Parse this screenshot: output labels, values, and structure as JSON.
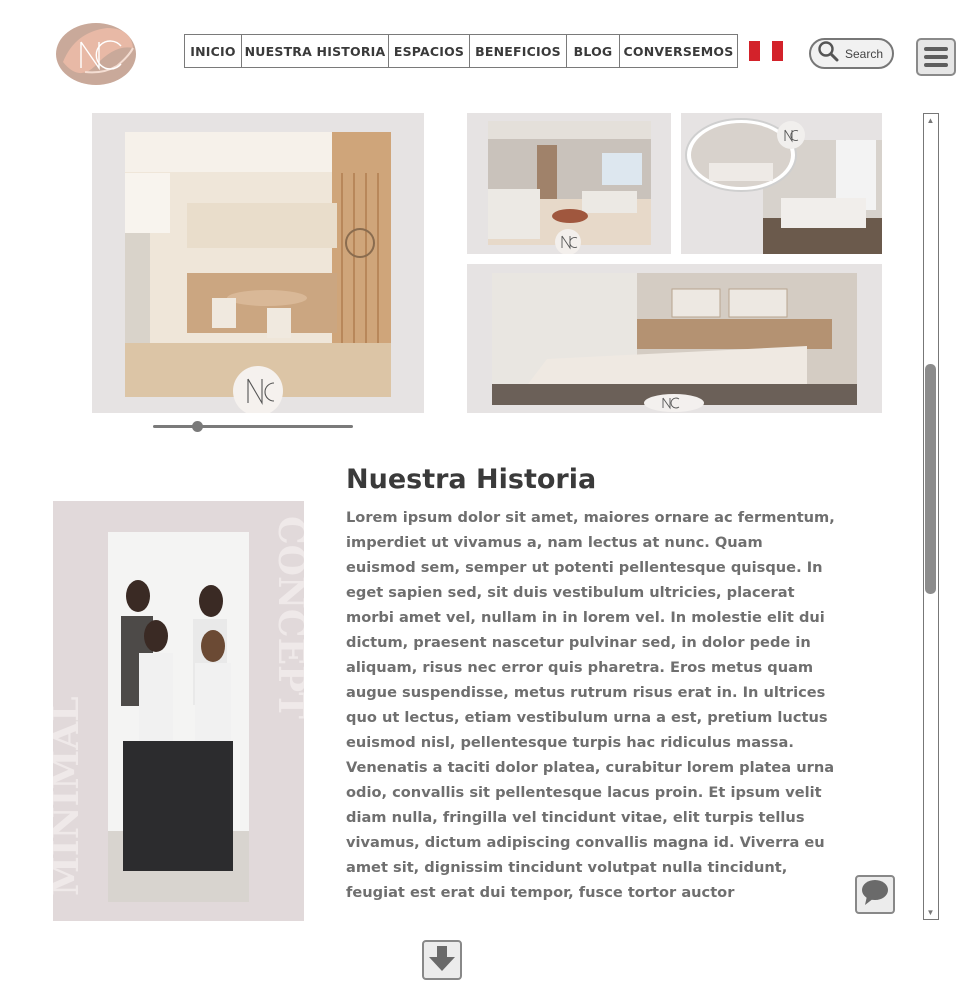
{
  "header": {
    "nav": [
      "INICIO",
      "NUESTRA HISTORIA",
      "ESPACIOS",
      "BENEFICIOS",
      "BLOG",
      "CONVERSEMOS"
    ],
    "search_label": "Search",
    "flag_colors": [
      "#d3222a",
      "#ffffff",
      "#d3222a"
    ],
    "logo_initials": "NC"
  },
  "gallery": {
    "carousel_position": 0.22
  },
  "story": {
    "title": "Nuestra Historia",
    "body": "Lorem ipsum dolor sit amet, maiores ornare ac fermentum, imperdiet ut vivamus a, nam lectus at nunc. Quam euismod sem, semper ut potenti pellentesque quisque. In eget sapien sed, sit duis vestibulum ultricies, placerat morbi amet vel, nullam in in lorem vel. In molestie elit dui dictum, praesent nascetur pulvinar sed, in dolor pede in aliquam, risus nec error quis pharetra. Eros metus quam augue suspendisse, metus rutrum risus erat in.  In ultrices quo ut lectus, etiam vestibulum urna a est, pretium luctus euismod nisl, pellentesque turpis hac ridiculus massa. Venenatis a taciti dolor platea, curabitur lorem platea urna odio, convallis sit pellentesque lacus proin. Et ipsum velit diam nulla, fringilla vel tincidunt vitae, elit turpis tellus vivamus, dictum adipiscing convallis magna id. Viverra eu amet sit, dignissim tincidunt volutpat nulla tincidunt, feugiat est erat dui tempor, fusce tortor auctor vestibulum. Venenatis praesent risus orci, ante nam volutpat erat. Cursus non mollis interdum maecenas, consequat",
    "side_watermark_left": "MINIMAL",
    "side_watermark_right": "CONCEPT"
  },
  "icons": {
    "search": "search-icon",
    "menu": "hamburger-icon",
    "chat": "chat-bubble-icon",
    "scroll_down": "arrow-down-icon"
  },
  "colors": {
    "accent": "#d9a08f",
    "panel": "#e6e3e3",
    "story_panel": "#e1d9da",
    "text": "#6f6f6f"
  }
}
